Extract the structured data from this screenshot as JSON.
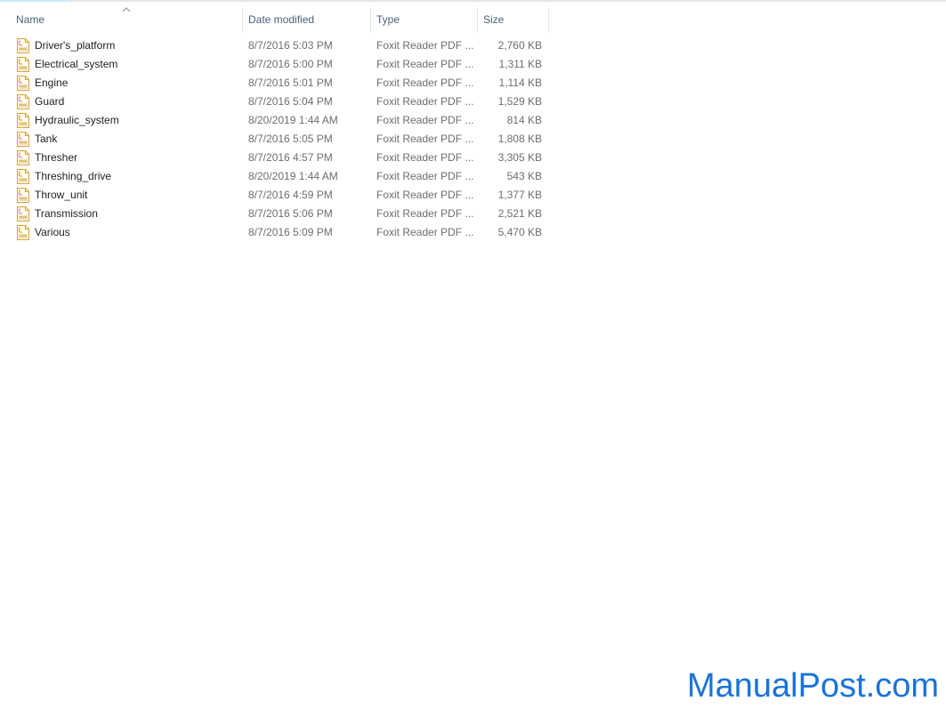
{
  "columns": {
    "name": "Name",
    "date_modified": "Date modified",
    "type": "Type",
    "size": "Size"
  },
  "files": [
    {
      "name": "Driver's_platform",
      "date": "8/7/2016 5:03 PM",
      "type": "Foxit Reader PDF ...",
      "size": "2,760 KB",
      "icon": "pdf-file-icon"
    },
    {
      "name": "Electrical_system",
      "date": "8/7/2016 5:00 PM",
      "type": "Foxit Reader PDF ...",
      "size": "1,311 KB",
      "icon": "pdf-file-icon"
    },
    {
      "name": "Engine",
      "date": "8/7/2016 5:01 PM",
      "type": "Foxit Reader PDF ...",
      "size": "1,114 KB",
      "icon": "pdf-file-icon"
    },
    {
      "name": "Guard",
      "date": "8/7/2016 5:04 PM",
      "type": "Foxit Reader PDF ...",
      "size": "1,529 KB",
      "icon": "pdf-file-icon"
    },
    {
      "name": "Hydraulic_system",
      "date": "8/20/2019 1:44 AM",
      "type": "Foxit Reader PDF ...",
      "size": "814 KB",
      "icon": "pdf-file-icon"
    },
    {
      "name": "Tank",
      "date": "8/7/2016 5:05 PM",
      "type": "Foxit Reader PDF ...",
      "size": "1,808 KB",
      "icon": "pdf-file-icon"
    },
    {
      "name": "Thresher",
      "date": "8/7/2016 4:57 PM",
      "type": "Foxit Reader PDF ...",
      "size": "3,305 KB",
      "icon": "pdf-file-icon"
    },
    {
      "name": "Threshing_drive",
      "date": "8/20/2019 1:44 AM",
      "type": "Foxit Reader PDF ...",
      "size": "543 KB",
      "icon": "pdf-file-icon"
    },
    {
      "name": "Throw_unit",
      "date": "8/7/2016 4:59 PM",
      "type": "Foxit Reader PDF ...",
      "size": "1,377 KB",
      "icon": "pdf-file-icon"
    },
    {
      "name": "Transmission",
      "date": "8/7/2016 5:06 PM",
      "type": "Foxit Reader PDF ...",
      "size": "2,521 KB",
      "icon": "pdf-file-icon"
    },
    {
      "name": "Various",
      "date": "8/7/2016 5:09 PM",
      "type": "Foxit Reader PDF ...",
      "size": "5,470 KB",
      "icon": "pdf-file-icon"
    }
  ],
  "sort": {
    "icon": "chevron-up-icon"
  },
  "watermark": "ManualPost.com",
  "colors": {
    "header_text": "#4c607a",
    "icon_accent": "#d6a23a",
    "watermark": "#1a73d9"
  }
}
